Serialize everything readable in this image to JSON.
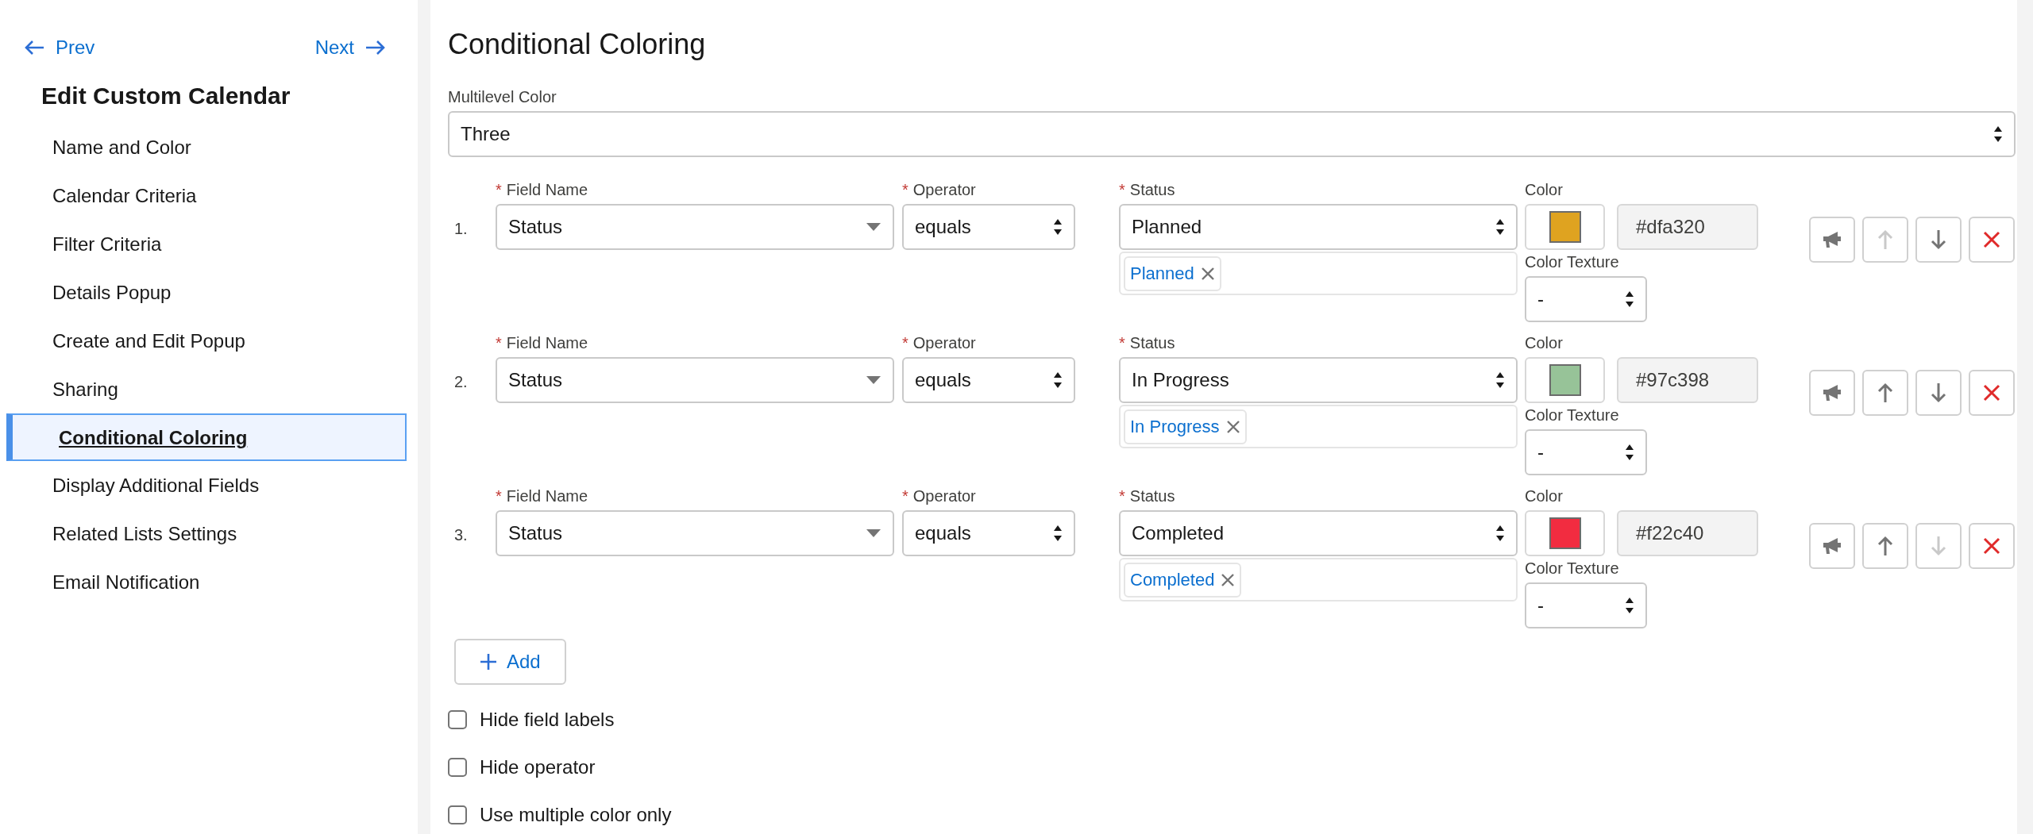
{
  "nav": {
    "prev": "Prev",
    "next": "Next"
  },
  "sidebar": {
    "title": "Edit Custom Calendar",
    "items": [
      {
        "label": "Name and Color",
        "selected": false
      },
      {
        "label": "Calendar Criteria",
        "selected": false
      },
      {
        "label": "Filter Criteria",
        "selected": false
      },
      {
        "label": "Details Popup",
        "selected": false
      },
      {
        "label": "Create and Edit Popup",
        "selected": false
      },
      {
        "label": "Sharing",
        "selected": false
      },
      {
        "label": "Conditional Coloring",
        "selected": true
      },
      {
        "label": "Display Additional Fields",
        "selected": false
      },
      {
        "label": "Related Lists Settings",
        "selected": false
      },
      {
        "label": "Email Notification",
        "selected": false
      }
    ]
  },
  "main": {
    "title": "Conditional Coloring",
    "multilevel": {
      "label": "Multilevel Color",
      "value": "Three"
    },
    "rules": [
      {
        "number": "1.",
        "field_label": "Field Name",
        "field_mark": "*",
        "field_value": "Status",
        "operator_label": "Operator",
        "operator_mark": "*",
        "operator_value": "equals",
        "status_label": "Status",
        "status_mark": "*",
        "status_value": "Planned",
        "tags": [
          "Planned"
        ],
        "color_label": "Color",
        "color": "#dfa320",
        "hex": "#dfa320",
        "texture_label": "Color Texture",
        "texture_value": "-",
        "up_disabled": true,
        "down_disabled": false
      },
      {
        "number": "2.",
        "field_label": "Field Name",
        "field_mark": "*",
        "field_value": "Status",
        "operator_label": "Operator",
        "operator_mark": "*",
        "operator_value": "equals",
        "status_label": "Status",
        "status_mark": "*",
        "status_value": "In Progress",
        "tags": [
          "In Progress"
        ],
        "color_label": "Color",
        "color": "#97c398",
        "hex": "#97c398",
        "texture_label": "Color Texture",
        "texture_value": "-",
        "up_disabled": false,
        "down_disabled": false
      },
      {
        "number": "3.",
        "field_label": "Field Name",
        "field_mark": "*",
        "field_value": "Status",
        "operator_label": "Operator",
        "operator_mark": "*",
        "operator_value": "equals",
        "status_label": "Status",
        "status_mark": "*",
        "status_value": "Completed",
        "tags": [
          "Completed"
        ],
        "color_label": "Color",
        "color": "#f22c40",
        "hex": "#f22c40",
        "texture_label": "Color Texture",
        "texture_value": "-",
        "up_disabled": false,
        "down_disabled": true
      }
    ],
    "add_button": "Add",
    "options": [
      {
        "label": "Hide field labels",
        "checked": false
      },
      {
        "label": "Hide operator",
        "checked": false
      },
      {
        "label": "Use multiple color only",
        "checked": false
      }
    ]
  }
}
